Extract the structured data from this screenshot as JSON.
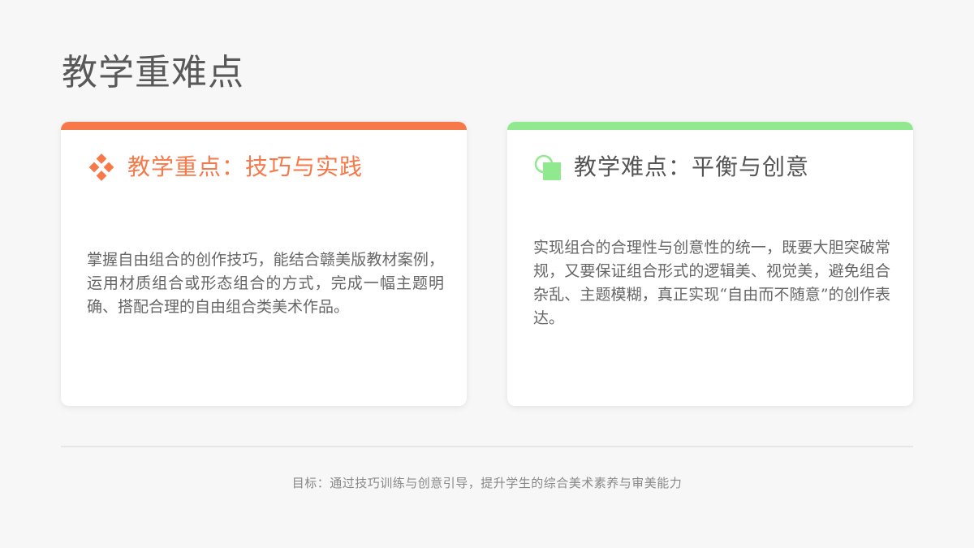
{
  "page": {
    "title": "教学重难点"
  },
  "cards": [
    {
      "title": "教学重点：技巧与实践",
      "icon": "diamond-cluster-icon",
      "accent_color": "#f7794a",
      "body": "掌握自由组合的创作技巧，能结合赣美版教材案例，运用材质组合或形态组合的方式，完成一幅主题明确、搭配合理的自由组合类美术作品。"
    },
    {
      "title": "教学难点：平衡与创意",
      "icon": "circle-square-icon",
      "accent_color": "#90e98e",
      "body": "实现组合的合理性与创意性的统一，既要大胆突破常规，又要保证组合形式的逻辑美、视觉美，避免组合杂乱、主题模糊，真正实现“自由而不随意”的创作表达。"
    }
  ],
  "footer": {
    "text": "目标：通过技巧训练与创意引导，提升学生的综合美术素养与审美能力"
  }
}
